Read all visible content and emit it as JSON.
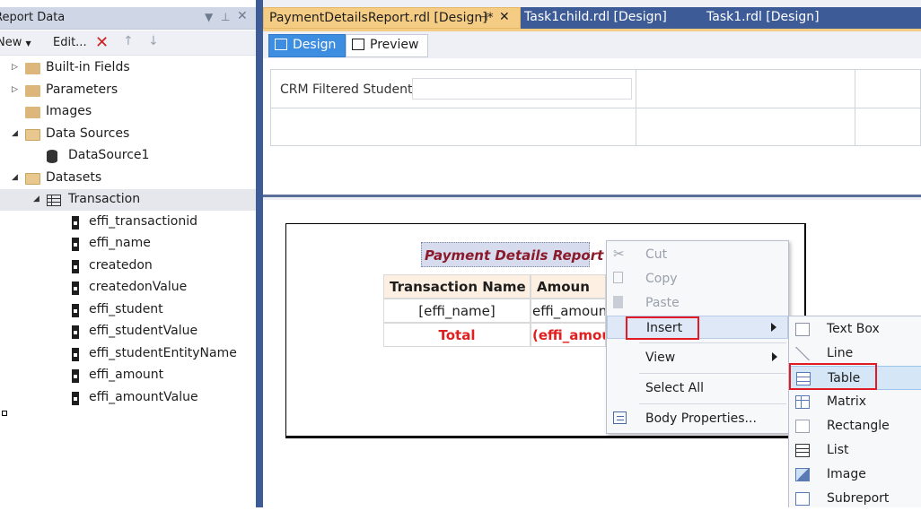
{
  "left_panel": {
    "title": "Report Data",
    "toolbar": {
      "new_label": "New",
      "edit_label": "Edit..."
    },
    "tree": [
      {
        "label": "Built-in Fields",
        "icon": "folder-icon",
        "expander": "collapsed"
      },
      {
        "label": "Parameters",
        "icon": "folder-icon",
        "expander": "collapsed"
      },
      {
        "label": "Images",
        "icon": "folder-icon",
        "expander": "none"
      },
      {
        "label": "Data Sources",
        "icon": "folder-open-icon",
        "expander": "expanded"
      },
      {
        "label": "DataSource1",
        "icon": "database-icon",
        "expander": "none"
      },
      {
        "label": "Datasets",
        "icon": "folder-open-icon",
        "expander": "expanded"
      },
      {
        "label": "Transaction",
        "icon": "dataset-grid-icon",
        "expander": "expanded"
      },
      {
        "label": "effi_transactionid",
        "icon": "field-icon"
      },
      {
        "label": "effi_name",
        "icon": "field-icon"
      },
      {
        "label": "createdon",
        "icon": "field-icon"
      },
      {
        "label": "createdonValue",
        "icon": "field-icon"
      },
      {
        "label": "effi_student",
        "icon": "field-icon"
      },
      {
        "label": "effi_studentValue",
        "icon": "field-icon"
      },
      {
        "label": "effi_studentEntityName",
        "icon": "field-icon"
      },
      {
        "label": "effi_amount",
        "icon": "field-icon"
      },
      {
        "label": "effi_amountValue",
        "icon": "field-icon"
      }
    ]
  },
  "doc_tabs": [
    {
      "label": "PaymentDetailsReport.rdl [Design]*",
      "active": true
    },
    {
      "label": "Task1child.rdl [Design]",
      "active": false
    },
    {
      "label": "Task1.rdl [Design]",
      "active": false
    }
  ],
  "view_tabs": {
    "design": "Design",
    "preview": "Preview"
  },
  "parameters": {
    "label": "CRM Filtered Student",
    "value": ""
  },
  "report": {
    "title": "Payment Details Report",
    "headers": [
      "Transaction Name",
      "Amoun"
    ],
    "detail_row": [
      "[effi_name]",
      "effi_amountV"
    ],
    "total_row": [
      "Total",
      "(effi_amou"
    ]
  },
  "context_menu": {
    "items": [
      {
        "label": "Cut",
        "icon": "scissors-icon",
        "disabled": true
      },
      {
        "label": "Copy",
        "icon": "copy-icon",
        "disabled": true
      },
      {
        "label": "Paste",
        "icon": "paste-icon",
        "disabled": true
      },
      {
        "label": "Insert",
        "submenu": true
      },
      {
        "label": "View",
        "submenu": true
      },
      {
        "label": "Select All"
      },
      {
        "label": "Body Properties...",
        "icon": "properties-icon"
      }
    ]
  },
  "insert_submenu": {
    "items": [
      {
        "label": "Text Box",
        "icon": "textbox-icon"
      },
      {
        "label": "Line",
        "icon": "line-icon"
      },
      {
        "label": "Table",
        "icon": "table-icon"
      },
      {
        "label": "Matrix",
        "icon": "matrix-icon"
      },
      {
        "label": "Rectangle",
        "icon": "rectangle-icon"
      },
      {
        "label": "List",
        "icon": "list-icon"
      },
      {
        "label": "Image",
        "icon": "image-icon"
      },
      {
        "label": "Subreport",
        "icon": "subreport-icon"
      }
    ]
  },
  "colors": {
    "accent_blue": "#3d5b97",
    "active_tab": "#f5cc84",
    "highlight_red": "#e01b24",
    "title_text": "#8b1a2b"
  }
}
